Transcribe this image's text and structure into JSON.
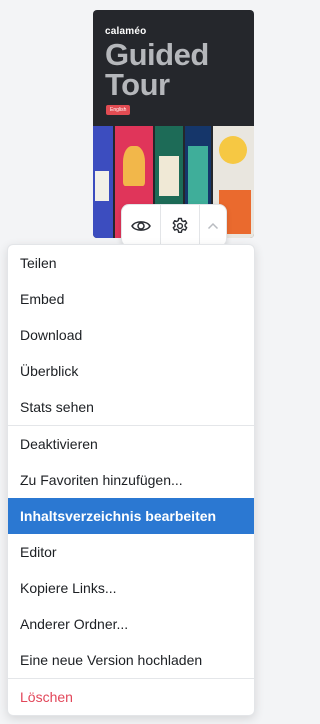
{
  "document": {
    "brand": "calaméo",
    "title_line1": "Guided",
    "title_line2": "Tour",
    "language_badge": "English"
  },
  "menu": {
    "group1": [
      "Teilen",
      "Embed",
      "Download",
      "Überblick",
      "Stats sehen"
    ],
    "group2": [
      "Deaktivieren",
      "Zu Favoriten hinzufügen...",
      "Inhaltsverzeichnis bearbeiten",
      "Editor",
      "Kopiere Links...",
      "Anderer Ordner...",
      "Eine neue Version hochladen"
    ],
    "group3": [
      "Löschen"
    ],
    "highlighted": "Inhaltsverzeichnis bearbeiten"
  },
  "colors": {
    "highlight": "#2b78d2",
    "danger": "#e2475a"
  }
}
